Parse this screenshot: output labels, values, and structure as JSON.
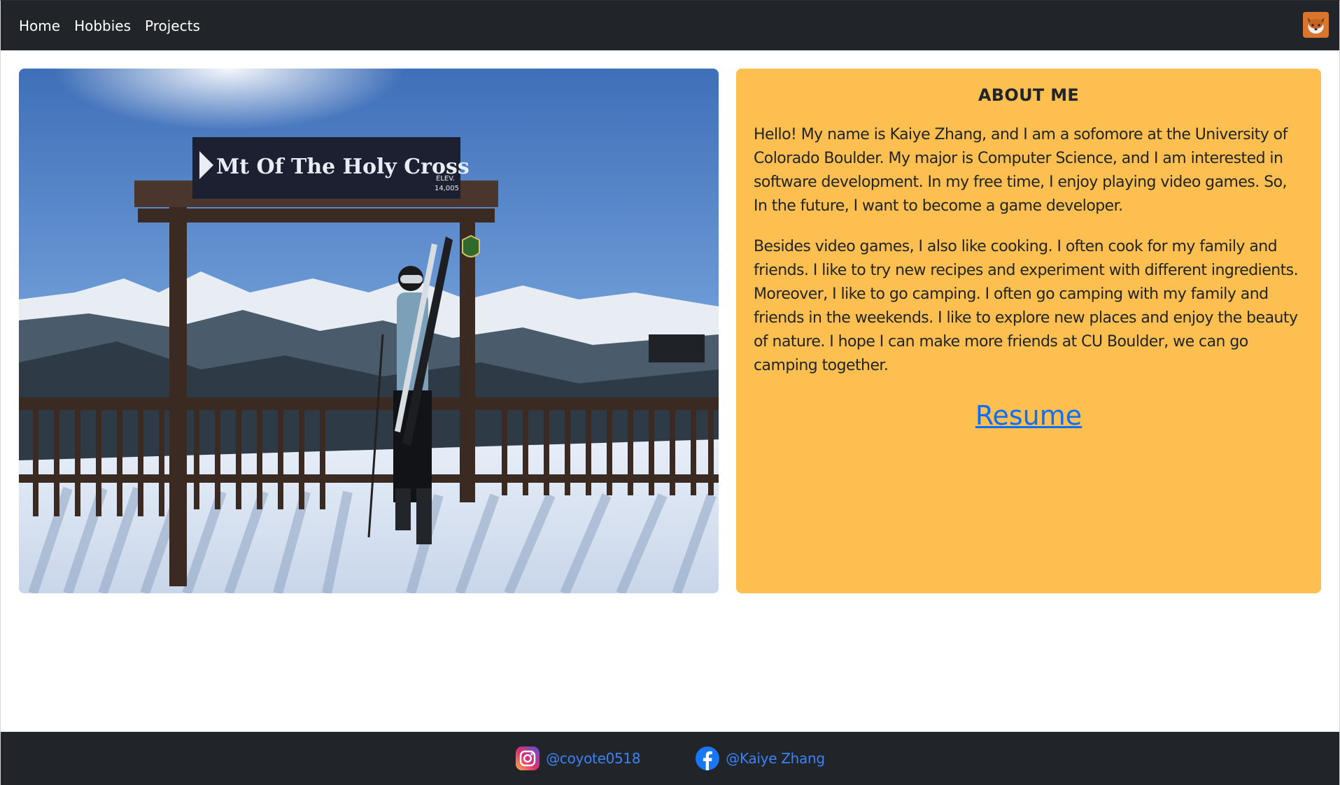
{
  "nav": {
    "items": [
      {
        "label": "Home"
      },
      {
        "label": "Hobbies"
      },
      {
        "label": "Projects"
      }
    ]
  },
  "photo": {
    "sign_text": "Mt Of The Holy Cross",
    "sign_elev": "ELEV.",
    "sign_elev_value": "14,005"
  },
  "about": {
    "title": "ABOUT ME",
    "paragraph1": "Hello! My name is Kaiye Zhang, and I am a sofomore at the University of Colorado Boulder. My major is Computer Science, and I am interested in software development. In my free time, I enjoy playing video games. So, In the future, I want to become a game developer.",
    "paragraph2": "Besides video games, I also like cooking. I often cook for my family and friends. I like to try new recipes and experiment with different ingredients. Moreover, I like to go camping. I often go camping with my family and friends in the weekends. I like to explore new places and enjoy the beauty of nature. I hope I can make more friends at CU Boulder, we can go camping together.",
    "resume_label": "Resume"
  },
  "footer": {
    "instagram_label": "@coyote0518",
    "facebook_label": "@Kaiye Zhang"
  },
  "colors": {
    "navbar": "#212529",
    "about_bg": "#fdbf50",
    "link": "#0d6efd"
  }
}
